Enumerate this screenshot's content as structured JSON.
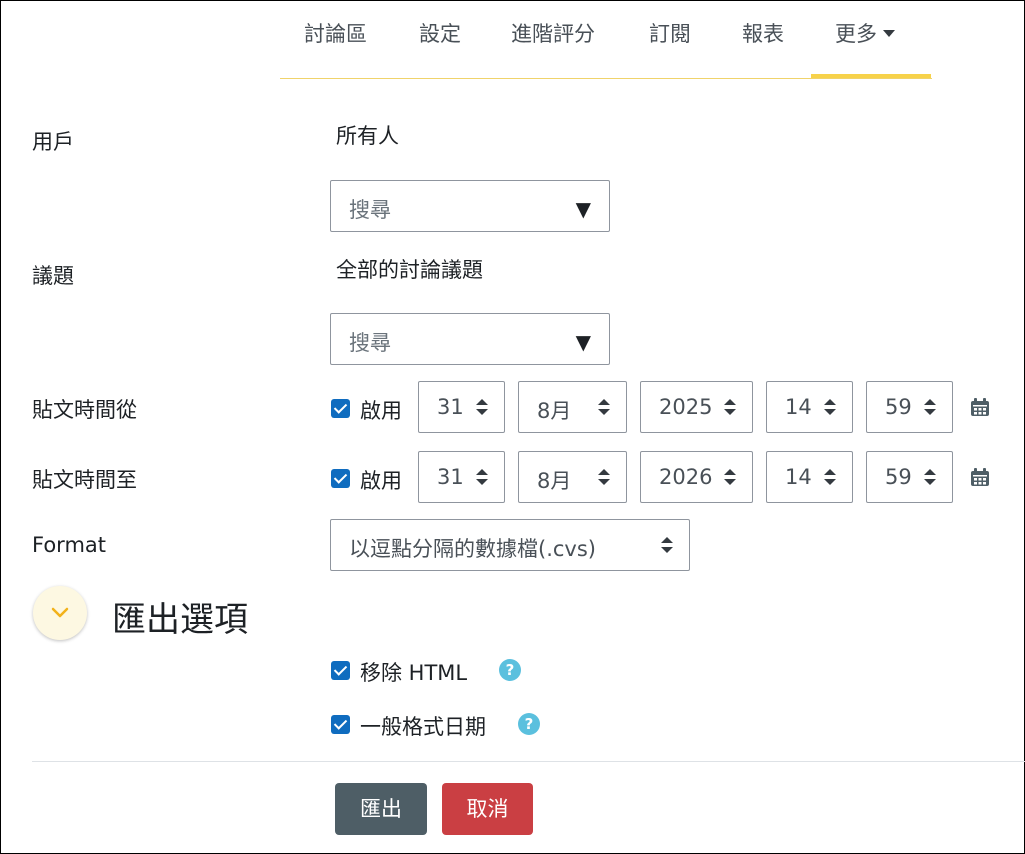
{
  "nav": {
    "items": [
      "討論區",
      "設定",
      "進階評分",
      "訂閱",
      "報表"
    ],
    "more_label": "更多",
    "active_color": "#f7d24a"
  },
  "form": {
    "users": {
      "label": "用戶",
      "value": "所有人",
      "search_placeholder": "搜尋"
    },
    "discussions": {
      "label": "議題",
      "value": "全部的討論議題",
      "search_placeholder": "搜尋"
    },
    "date_from": {
      "label": "貼文時間從",
      "enable_label": "啟用",
      "enabled": true,
      "day": "31",
      "month": "8月",
      "year": "2025",
      "hour": "14",
      "minute": "59"
    },
    "date_to": {
      "label": "貼文時間至",
      "enable_label": "啟用",
      "enabled": true,
      "day": "31",
      "month": "8月",
      "year": "2026",
      "hour": "14",
      "minute": "59"
    },
    "format": {
      "label": "Format",
      "value": "以逗點分隔的數據檔(.cvs)"
    }
  },
  "export_options": {
    "title": "匯出選項",
    "remove_html": {
      "label": "移除 HTML",
      "checked": true
    },
    "human_dates": {
      "label": "一般格式日期",
      "checked": true
    },
    "help_glyph": "?"
  },
  "buttons": {
    "export": "匯出",
    "cancel": "取消"
  },
  "colors": {
    "primary": "#0f6cbf",
    "export_btn": "#4e5e66",
    "cancel_btn": "#ca3f43",
    "help": "#5bc0de"
  }
}
